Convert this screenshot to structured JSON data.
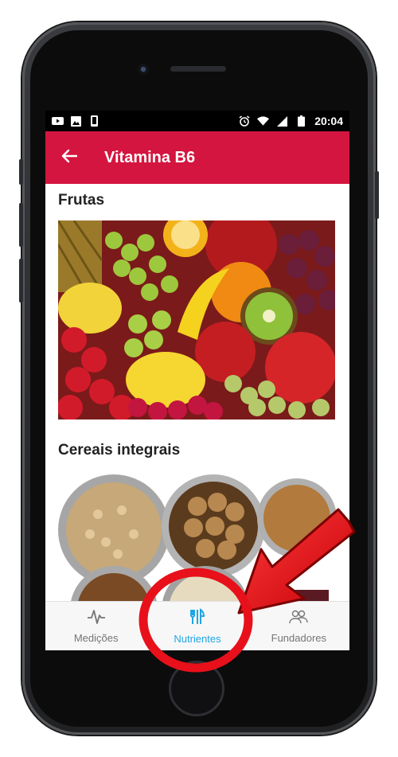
{
  "statusbar": {
    "left_icons": [
      "youtube-icon",
      "image-icon",
      "phone-icon"
    ],
    "right_icons": [
      "alarm-icon",
      "wifi-icon",
      "signal-icon",
      "battery-icon"
    ],
    "time": "20:04"
  },
  "appbar": {
    "back_icon": "arrow-left-icon",
    "title": "Vitamina B6"
  },
  "sections": [
    {
      "title": "Frutas"
    },
    {
      "title": "Cereais integrais"
    }
  ],
  "tabs": [
    {
      "label": "Medições",
      "icon": "pulse-icon",
      "active": false
    },
    {
      "label": "Nutrientes",
      "icon": "cutlery-icon",
      "active": true
    },
    {
      "label": "Fundadores",
      "icon": "people-icon",
      "active": false
    }
  ],
  "colors": {
    "appbar": "#d4153f",
    "active_tab": "#1ea6e5",
    "inactive_tab": "#757575",
    "annotation": "#e8101a"
  }
}
